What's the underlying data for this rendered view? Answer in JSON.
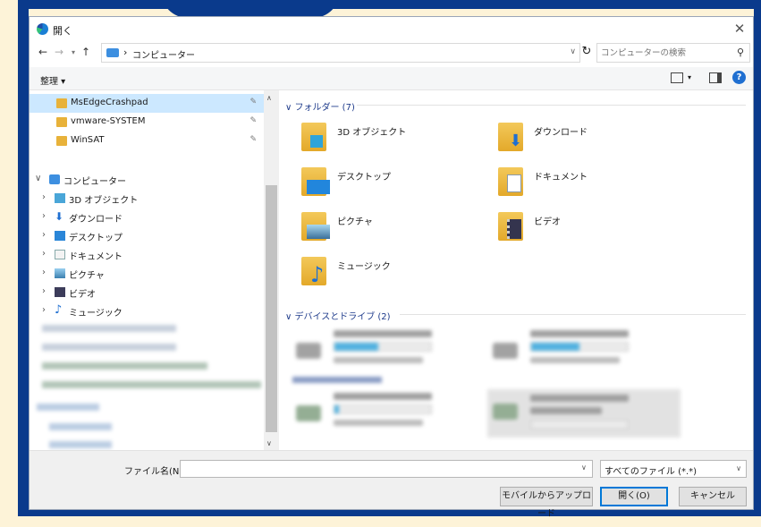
{
  "window": {
    "title": "開く",
    "close_label": "✕"
  },
  "address": {
    "location": "コンピューター",
    "search_placeholder": "コンピューターの検索"
  },
  "toolbar": {
    "organize": "整理 ▾"
  },
  "nav": {
    "quick": [
      {
        "label": "MsEdgeCrashpad",
        "pinned": true
      },
      {
        "label": "vmware-SYSTEM",
        "pinned": true
      },
      {
        "label": "WinSAT",
        "pinned": true
      }
    ],
    "computer_label": "コンピューター",
    "children": [
      {
        "label": "3D オブジェクト",
        "icon": "3d-objects-icon"
      },
      {
        "label": "ダウンロード",
        "icon": "download-icon"
      },
      {
        "label": "デスクトップ",
        "icon": "desktop-icon"
      },
      {
        "label": "ドキュメント",
        "icon": "documents-icon"
      },
      {
        "label": "ピクチャ",
        "icon": "pictures-icon"
      },
      {
        "label": "ビデオ",
        "icon": "videos-icon"
      },
      {
        "label": "ミュージック",
        "icon": "music-icon"
      }
    ]
  },
  "content": {
    "folders_header": "フォルダー (7)",
    "folders": [
      {
        "label": "3D オブジェクト"
      },
      {
        "label": "ダウンロード"
      },
      {
        "label": "デスクトップ"
      },
      {
        "label": "ドキュメント"
      },
      {
        "label": "ピクチャ"
      },
      {
        "label": "ビデオ"
      },
      {
        "label": "ミュージック"
      }
    ],
    "drives_header": "デバイスとドライブ (2)",
    "drives": [
      {
        "fill": 0.45
      },
      {
        "fill": 0.5
      }
    ],
    "network": [
      {
        "fill": 0.05
      },
      {
        "fill": 0.0
      }
    ]
  },
  "bottom": {
    "filename_label": "ファイル名(N):",
    "filename_value": "",
    "filetype": "すべてのファイル (*.*)",
    "mobile_button": "モバイルからアップロード",
    "open_button": "開く(O)",
    "cancel_button": "キャンセル"
  },
  "colors": {
    "accent": "#0078d7",
    "selected": "#cce8ff",
    "frame": "#0a3a8c",
    "group": "#1e3b8b"
  }
}
